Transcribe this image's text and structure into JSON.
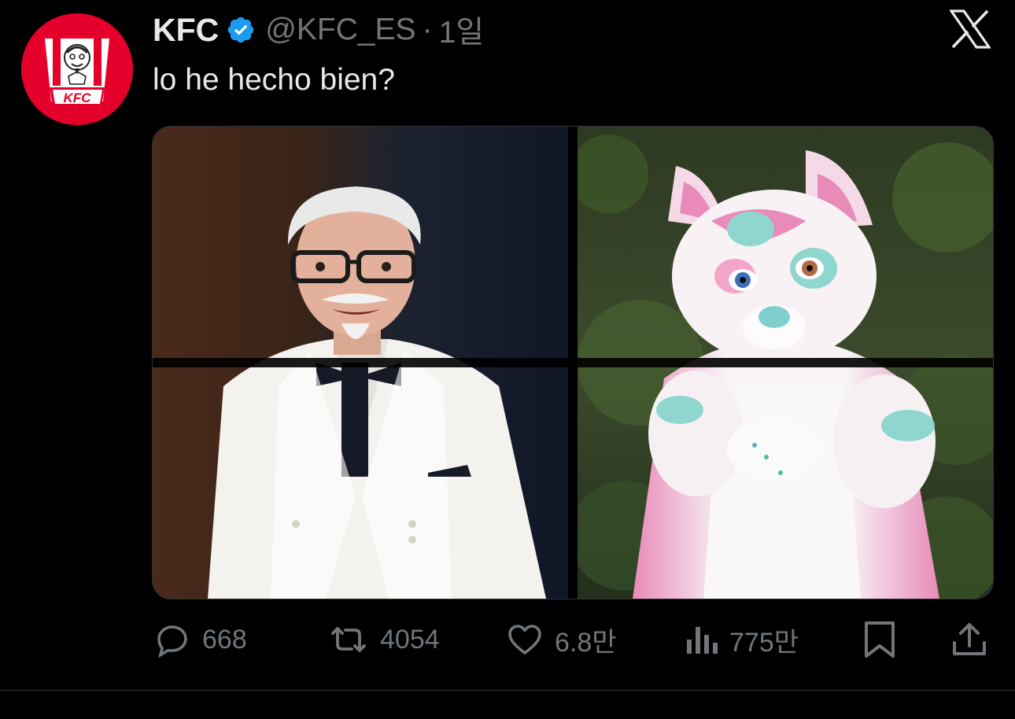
{
  "author": {
    "display_name": "KFC",
    "handle": "@KFC_ES",
    "separator": "·",
    "time": "1일",
    "verified": true,
    "avatar_text": "KFC"
  },
  "tweet": {
    "text": "lo he hecho bien?"
  },
  "media": {
    "count": 2,
    "left_image": "colonel-sanders-photo",
    "right_image": "pink-furry-fursuit-photo"
  },
  "actions": {
    "replies": "668",
    "reposts": "4054",
    "likes": "6.8만",
    "views": "775만"
  },
  "icons": {
    "verified": "verified-badge-icon",
    "platform": "x-logo-icon",
    "reply": "reply-icon",
    "repost": "repost-icon",
    "like": "heart-icon",
    "views": "views-icon",
    "bookmark": "bookmark-icon",
    "share": "share-icon"
  },
  "colors": {
    "background": "#000000",
    "text_primary": "#e7e9ea",
    "text_secondary": "#71767b",
    "verified_blue": "#1d9bf0",
    "kfc_red": "#e4002b"
  }
}
